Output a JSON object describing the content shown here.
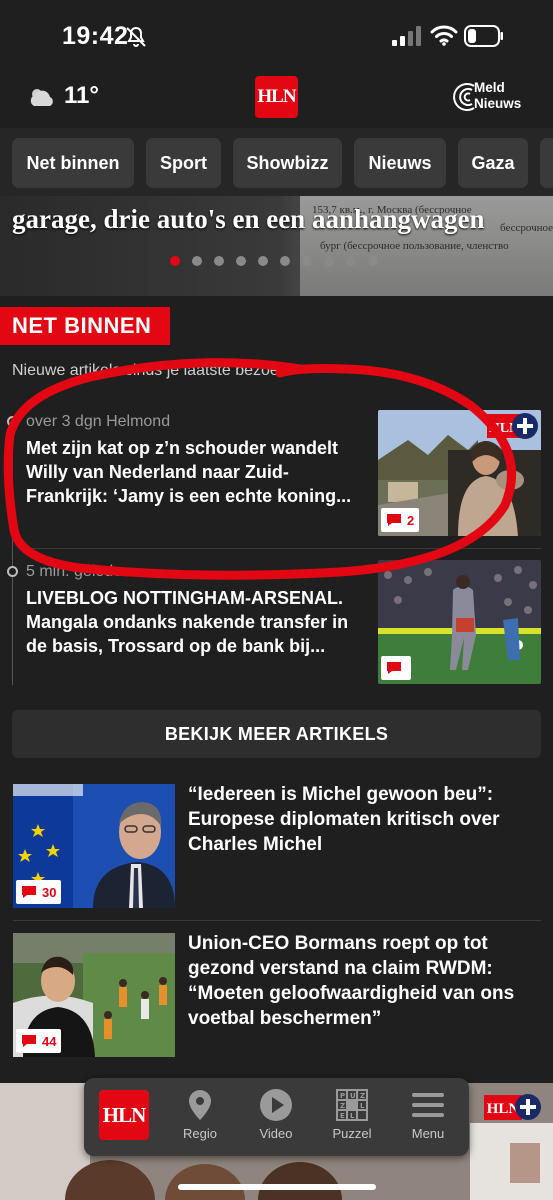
{
  "status_bar": {
    "time": "19:42",
    "icons": [
      "bell-muted-icon",
      "signal-icon",
      "wifi-icon",
      "battery-icon"
    ]
  },
  "header": {
    "temperature": "11°",
    "weather_icon": "cloud-sun-icon",
    "logo": "HLN",
    "meld_line1": "Meld",
    "meld_line2": "Nieuws"
  },
  "tabs": [
    {
      "label": "Net binnen"
    },
    {
      "label": "Sport"
    },
    {
      "label": "Showbizz"
    },
    {
      "label": "Nieuws"
    },
    {
      "label": "Gaza"
    }
  ],
  "hero": {
    "title": "garage, drie auto's en een aanhangwagen",
    "doc_line1": "153,7 кв.м., г. Москва (бессрочное",
    "doc_line2": "бург (бессрочное пользование, членство",
    "doc_line3": "бессрочное",
    "slide_count": 10,
    "active_slide": 0
  },
  "net_binnen": {
    "label": "NET BINNEN",
    "new_since": "Nieuwe artikels sinds je laatste bezoek",
    "articles": [
      {
        "time": "over 3 dgn",
        "location": "Helmond",
        "title": "Met zijn kat op z’n schouder wandelt Willy van Nederland naar Zuid-Frankrijk: ‘Jamy is een echte koning...",
        "comments": "2",
        "plus": true
      },
      {
        "time": "5 min. geleden",
        "location": "",
        "title": "LIVEBLOG NOTTINGHAM-ARSENAL. Mangala ondanks nakende transfer in de basis, Trossard op de bank bij...",
        "comments": "",
        "plus": false
      }
    ],
    "more_label": "BEKIJK MEER ARTIKELS"
  },
  "list_articles": [
    {
      "title": "“Iedereen is Michel gewoon beu”: Europese diplomaten kritisch over Charles Michel",
      "comments": "30"
    },
    {
      "title": "Union-CEO Bormans roept op tot gezond verstand na claim RWDM: “Moeten geloofwaardigheid van ons voetbal beschermen”",
      "comments": "44"
    }
  ],
  "bottom_nav": {
    "items": [
      {
        "label": "",
        "icon": "hln-logo"
      },
      {
        "label": "Regio",
        "icon": "location-pin-icon"
      },
      {
        "label": "Video",
        "icon": "play-icon"
      },
      {
        "label": "Puzzel",
        "icon": "puzzle-grid-icon"
      },
      {
        "label": "Menu",
        "icon": "hamburger-menu-icon"
      }
    ]
  },
  "colors": {
    "brand_red": "#e30613",
    "background": "#1f1f1f",
    "tab_bg": "#3a3a3a"
  }
}
